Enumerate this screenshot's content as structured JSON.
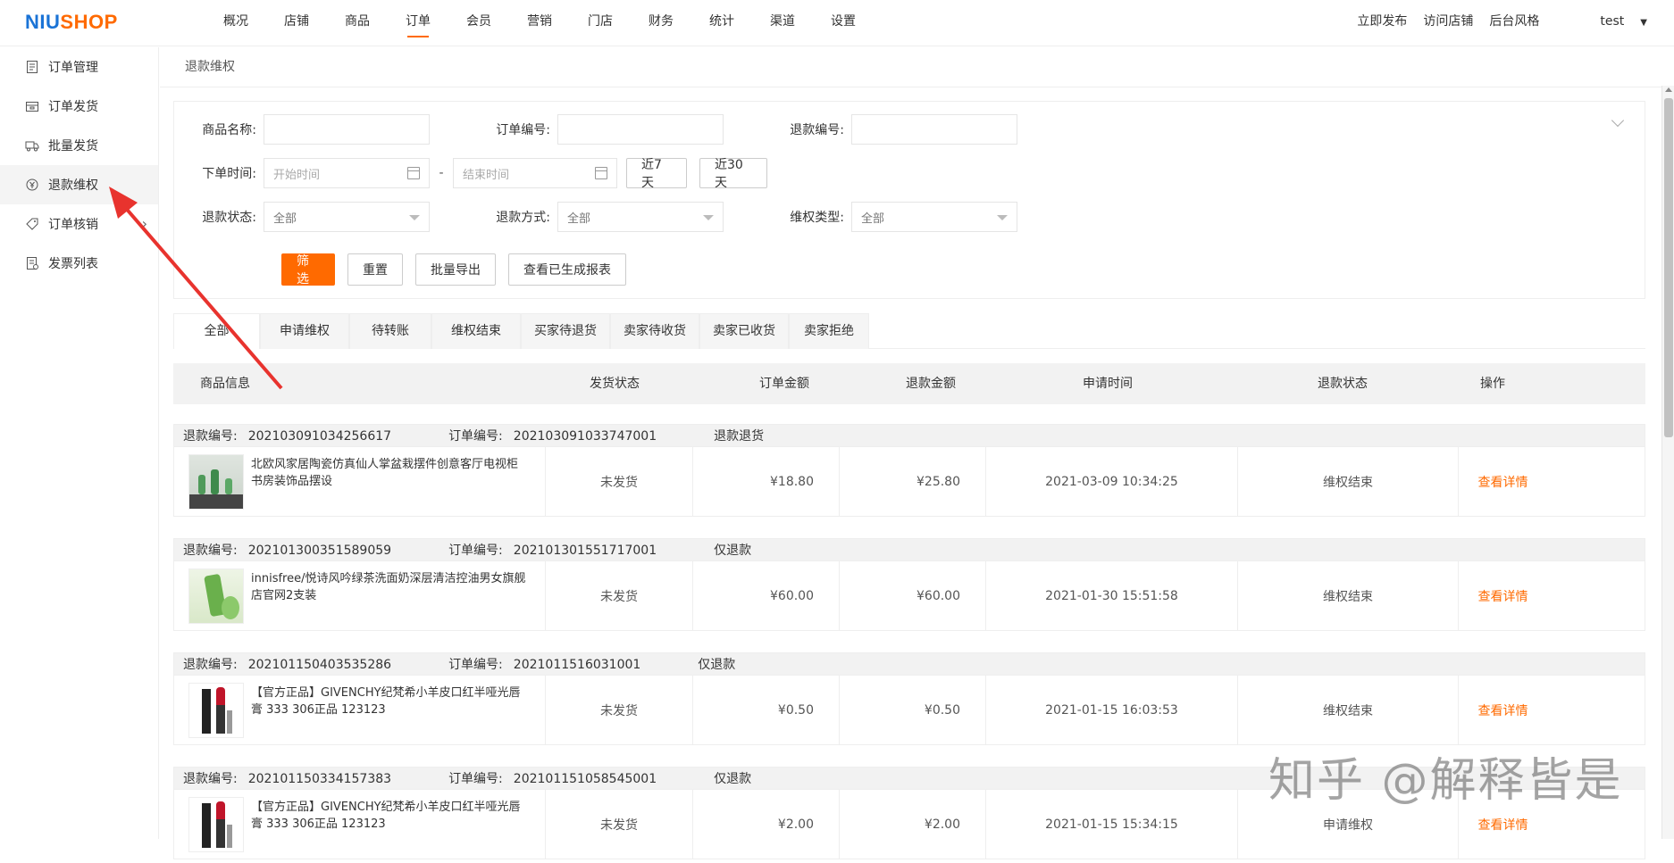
{
  "app": {
    "logo_a": "NIU",
    "logo_b": "SHOP"
  },
  "nav": [
    "概况",
    "店铺",
    "商品",
    "订单",
    "会员",
    "营销",
    "门店",
    "财务",
    "统计",
    "渠道",
    "设置"
  ],
  "top_right": {
    "publish": "立即发布",
    "visit": "访问店铺",
    "theme": "后台风格",
    "user": "test"
  },
  "sidebar": [
    "订单管理",
    "订单发货",
    "批量发货",
    "退款维权",
    "订单核销",
    "发票列表"
  ],
  "breadcrumb": "退款维权",
  "filters": {
    "product_name_label": "商品名称:",
    "order_no_label": "订单编号:",
    "refund_no_label": "退款编号:",
    "order_time_label": "下单时间:",
    "start_placeholder": "开始时间",
    "end_placeholder": "结束时间",
    "dash": "-",
    "last7": "近7天",
    "last30": "近30天",
    "refund_status_label": "退款状态:",
    "refund_status_value": "全部",
    "refund_method_label": "退款方式:",
    "refund_method_value": "全部",
    "type_label": "维权类型:",
    "type_value": "全部",
    "btn_filter": "筛选",
    "btn_reset": "重置",
    "btn_export": "批量导出",
    "btn_reports": "查看已生成报表"
  },
  "tabs": [
    "全部",
    "申请维权",
    "待转账",
    "维权结束",
    "买家待退货",
    "卖家待收货",
    "卖家已收货",
    "卖家拒绝"
  ],
  "table_headers": {
    "product": "商品信息",
    "ship": "发货状态",
    "order_amount": "订单金额",
    "refund_amount": "退款金额",
    "apply_time": "申请时间",
    "refund_status": "退款状态",
    "action": "操作"
  },
  "records": [
    {
      "refund_no_label": "退款编号:",
      "refund_no": "202103091034256617",
      "order_no_label": "订单编号:",
      "order_no": "202103091033747001",
      "method": "退款退货",
      "product": "北欧风家居陶瓷仿真仙人掌盆栽摆件创意客厅电视柜书房装饰品摆设",
      "ship": "未发货",
      "order_amount": "¥18.80",
      "refund_amount": "¥25.80",
      "time": "2021-03-09 10:34:25",
      "status": "维权结束",
      "action": "查看详情"
    },
    {
      "refund_no_label": "退款编号:",
      "refund_no": "202101300351589059",
      "order_no_label": "订单编号:",
      "order_no": "202101301551717001",
      "method": "仅退款",
      "product": "innisfree/悦诗风吟绿茶洗面奶深层清洁控油男女旗舰店官网2支装",
      "ship": "未发货",
      "order_amount": "¥60.00",
      "refund_amount": "¥60.00",
      "time": "2021-01-30 15:51:58",
      "status": "维权结束",
      "action": "查看详情"
    },
    {
      "refund_no_label": "退款编号:",
      "refund_no": "202101150403535286",
      "order_no_label": "订单编号:",
      "order_no": "2021011516031001",
      "method": "仅退款",
      "product": "【官方正品】GIVENCHY纪梵希小羊皮口红半哑光唇膏 333 306正品 123123",
      "ship": "未发货",
      "order_amount": "¥0.50",
      "refund_amount": "¥0.50",
      "time": "2021-01-15 16:03:53",
      "status": "维权结束",
      "action": "查看详情"
    },
    {
      "refund_no_label": "退款编号:",
      "refund_no": "202101150334157383",
      "order_no_label": "订单编号:",
      "order_no": "202101151058545001",
      "method": "仅退款",
      "product": "【官方正品】GIVENCHY纪梵希小羊皮口红半哑光唇膏 333 306正品 123123",
      "ship": "未发货",
      "order_amount": "¥2.00",
      "refund_amount": "¥2.00",
      "time": "2021-01-15 15:34:15",
      "status": "申请维权",
      "action": "查看详情"
    }
  ],
  "watermark": "知乎 @解释皆是",
  "colors": {
    "accent": "#ff6a00",
    "logo_blue": "#1a73d6",
    "annotation_arrow": "#e8332e"
  }
}
